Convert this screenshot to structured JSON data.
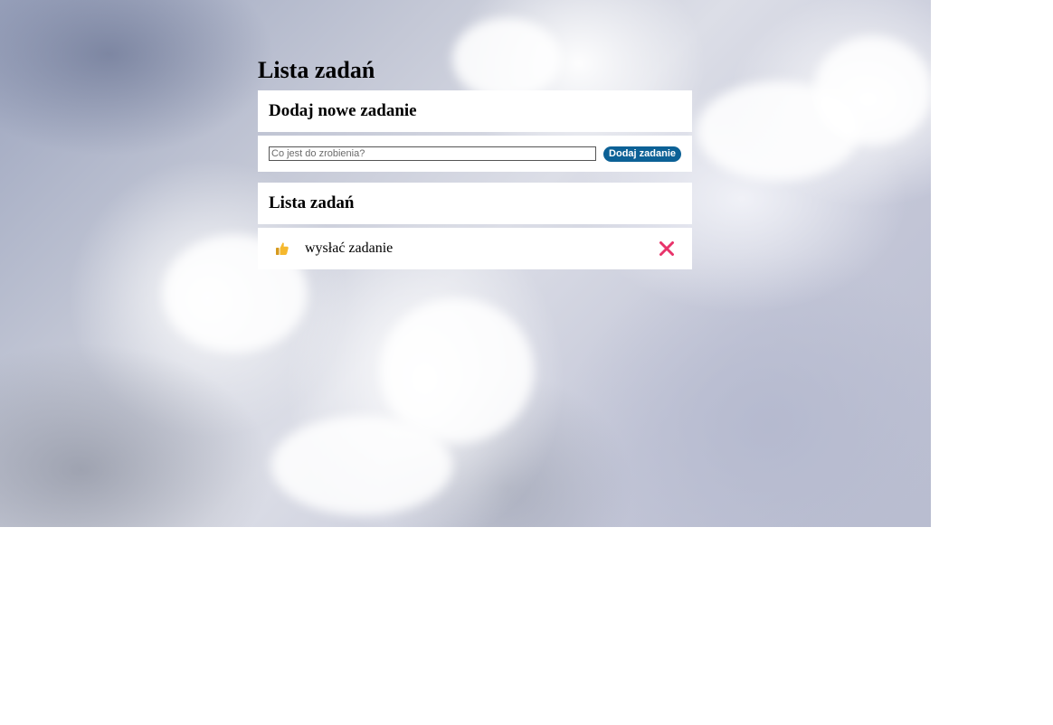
{
  "page": {
    "title": "Lista zadań"
  },
  "add_section": {
    "heading": "Dodaj nowe zadanie",
    "input_placeholder": "Co jest do zrobienia?",
    "input_value": "",
    "button_label": "Dodaj zadanie"
  },
  "list_section": {
    "heading": "Lista zadań",
    "items": [
      {
        "text": "wysłać zadanie",
        "status_icon": "thumbs-up-icon",
        "action_icon": "close-icon"
      }
    ]
  },
  "colors": {
    "button_bg": "#0c6196",
    "delete_icon": "#e8336a",
    "thumb_icon": "#f5b82e"
  }
}
